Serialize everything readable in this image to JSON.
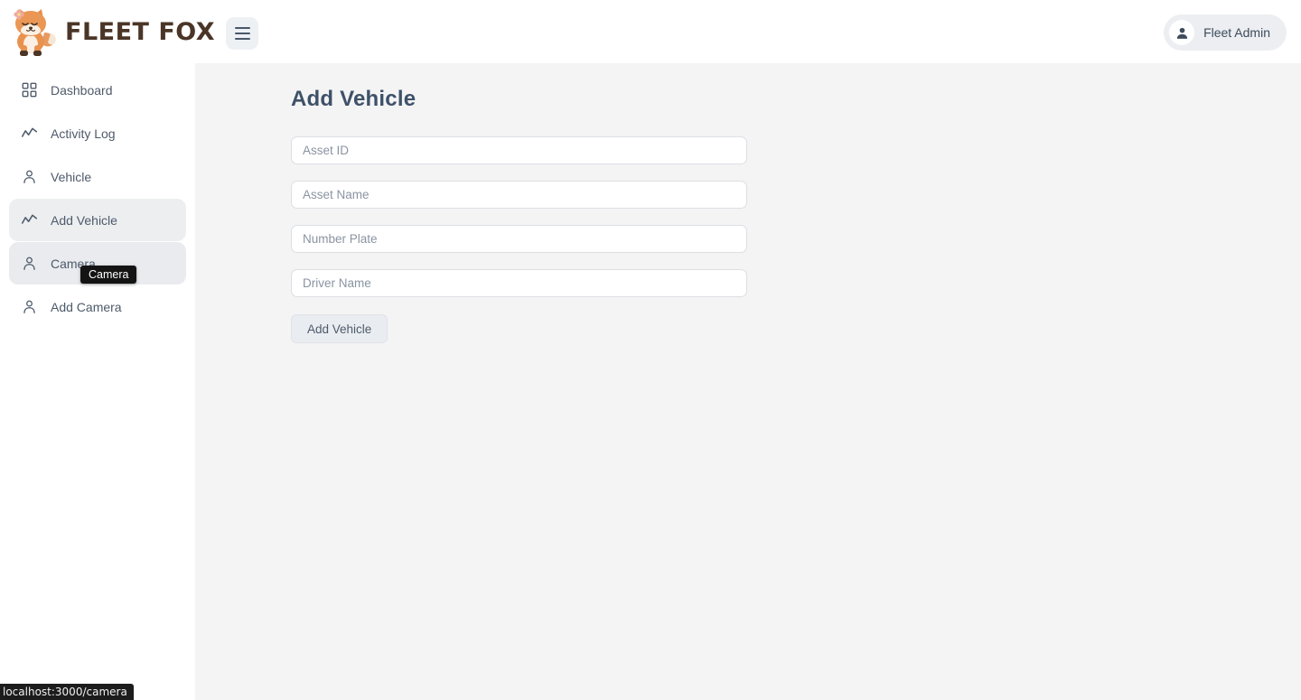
{
  "header": {
    "brand_name": "FLEET FOX",
    "logo_icon": "fox-logo-icon",
    "menu_icon": "hamburger-menu-icon",
    "user": {
      "name": "Fleet Admin",
      "avatar_icon": "person-filled-icon"
    }
  },
  "sidebar": {
    "items": [
      {
        "label": "Dashboard",
        "icon": "grid-dashboard-icon",
        "state": "default"
      },
      {
        "label": "Activity Log",
        "icon": "line-chart-icon",
        "state": "default"
      },
      {
        "label": "Vehicle",
        "icon": "person-outline-icon",
        "state": "default"
      },
      {
        "label": "Add Vehicle",
        "icon": "line-chart-icon",
        "state": "active"
      },
      {
        "label": "Camera",
        "icon": "person-outline-icon",
        "state": "hovered"
      },
      {
        "label": "Add Camera",
        "icon": "person-outline-icon",
        "state": "default"
      }
    ]
  },
  "tooltip": {
    "text": "Camera"
  },
  "main": {
    "page_title": "Add Vehicle",
    "fields": [
      {
        "name": "asset-id",
        "placeholder": "Asset ID",
        "value": ""
      },
      {
        "name": "asset-name",
        "placeholder": "Asset Name",
        "value": ""
      },
      {
        "name": "number-plate",
        "placeholder": "Number Plate",
        "value": ""
      },
      {
        "name": "driver-name",
        "placeholder": "Driver Name",
        "value": ""
      }
    ],
    "submit_label": "Add Vehicle"
  },
  "status_bar": {
    "url": "localhost:3000/camera"
  },
  "colors": {
    "brand_text": "#4a3527",
    "fox_orange": "#e08a4e",
    "title": "#3e5168",
    "nav_text": "#4e5a6a",
    "nav_active_bg": "#eceef0",
    "content_bg": "#f4f4f5",
    "tooltip_bg": "#141414"
  }
}
